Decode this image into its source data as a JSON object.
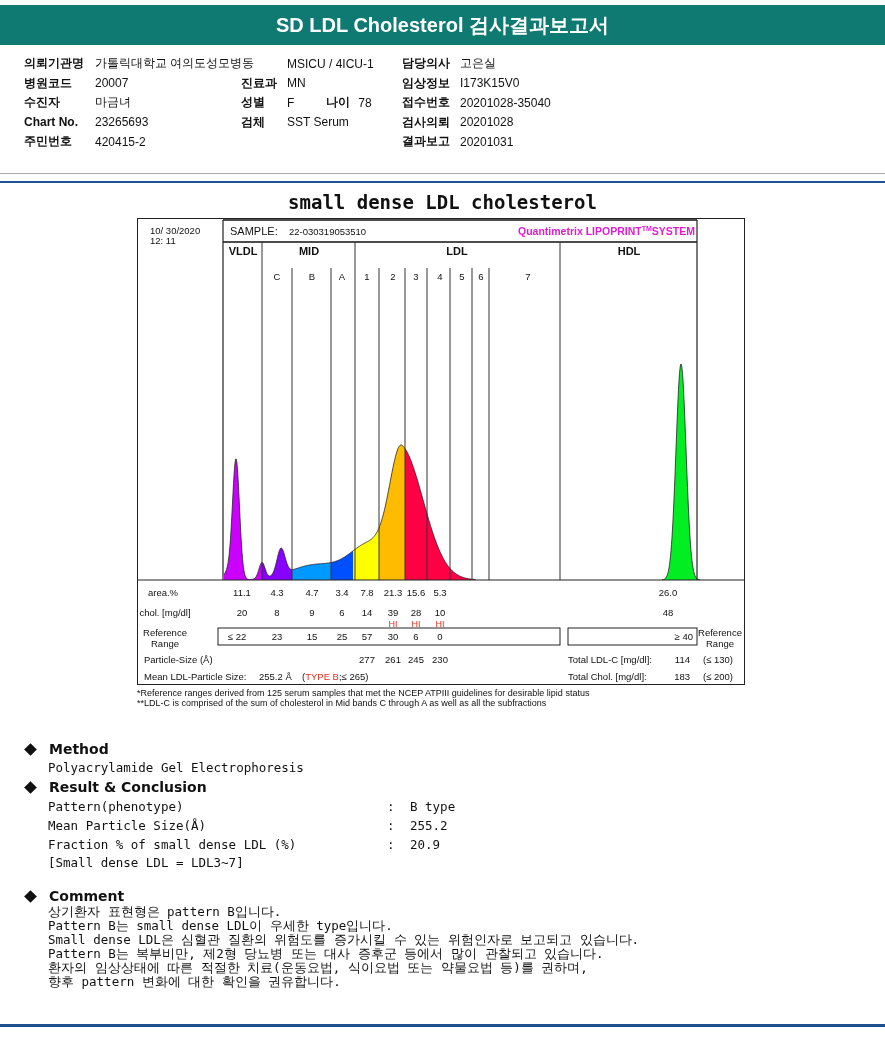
{
  "header": {
    "title": "SD LDL Cholesterol 검사결과보고서"
  },
  "info_rows": [
    {
      "left": {
        "label": "의뢰기관명",
        "value": "가톨릭대학교 여의도성모병동"
      },
      "middle": {
        "value": "MSICU / 4ICU-1"
      },
      "right": {
        "label": "담당의사",
        "value": "고은실"
      }
    },
    {
      "left": {
        "label": "병원코드",
        "value": "20007"
      },
      "middle": {
        "label": "진료과",
        "value": "MN"
      },
      "right": {
        "label": "임상정보",
        "value": "I173K15V0"
      }
    },
    {
      "left": {
        "label": "수진자",
        "value": "마금녀"
      },
      "middle": {
        "label": "성별",
        "value": "F",
        "extra": {
          "label": "나이",
          "value": "78"
        }
      },
      "right": {
        "label": "접수번호",
        "value": "20201028-35040"
      }
    },
    {
      "left": {
        "label": "Chart No.",
        "value": "23265693"
      },
      "middle": {
        "label": "검체",
        "value": "SST Serum"
      },
      "right": {
        "label": "검사의뢰",
        "value": "20201028"
      }
    },
    {
      "left": {
        "label": "주민번호",
        "value": "420415-2"
      },
      "right": {
        "label": "결과보고",
        "value": "20201031"
      }
    }
  ],
  "chart_title": "small dense LDL cholesterol",
  "report_figure": {
    "date": "10/ 30/2020",
    "time": "12: 11",
    "sample_label": "SAMPLE:",
    "sample_id": "22-030319053510",
    "system": {
      "name": "Quantimetrix LIPOPRINT",
      "mark": "TM",
      "suffix": "SYSTEM"
    },
    "band_groups": [
      "VLDL",
      "MID",
      "LDL",
      "HDL"
    ],
    "fractions": [
      {
        "area": "11.1",
        "chol": "20",
        "reference": "≤ 22"
      },
      {
        "label": "C",
        "area": "4.3",
        "chol": "8",
        "reference": "23"
      },
      {
        "label": "B",
        "area": "4.7",
        "chol": "9",
        "reference": "15"
      },
      {
        "label": "A",
        "area": "3.4",
        "chol": "6",
        "reference": "25"
      },
      {
        "label": "1",
        "area": "7.8",
        "chol": "14",
        "reference": "57",
        "particle_size": "277"
      },
      {
        "label": "2",
        "area": "21.3",
        "chol": "39",
        "chol_flag": "HI",
        "reference": "30",
        "particle_size": "261"
      },
      {
        "label": "3",
        "area": "15.6",
        "chol": "28",
        "chol_flag": "HI",
        "reference": "6",
        "particle_size": "245"
      },
      {
        "label": "4",
        "area": "5.3",
        "chol": "10",
        "chol_flag": "HI",
        "reference": "0",
        "particle_size": "230"
      },
      {
        "label": "5"
      },
      {
        "label": "6"
      },
      {
        "label": "7"
      },
      {
        "area": "26.0",
        "chol": "48",
        "reference": "≥ 40"
      }
    ],
    "row_labels": {
      "area": "area.%",
      "chol": "chol. [mg/dl]",
      "reference": "Reference Range",
      "reference_right": "Reference Range",
      "particle": "Particle-Size (Å)"
    },
    "particle": {
      "total_label": "Total LDL-C [mg/dl]:",
      "total_value": "114",
      "total_ref": "(≤ 130)"
    },
    "mean": {
      "label": "Mean LDL-Particle Size:",
      "value": "255.2 Å",
      "prefix": "(",
      "type": "TYPE B",
      "suffix": ";≤ 265)",
      "total_label": "Total Chol. [mg/dl]:",
      "total_value": "183",
      "total_ref": "(≤ 200)"
    },
    "footnotes": [
      "*Reference ranges derived from 125 serum samples that met the NCEP ATPIII guidelines for desirable lipid status",
      "**LDL-C is comprised of the sum of cholesterol in Mid bands C through A as well as all the subfractions"
    ]
  },
  "method": {
    "heading": "Method",
    "text": "Polyacrylamide Gel Electrophoresis"
  },
  "result": {
    "heading": "Result & Conclusion",
    "rows": [
      {
        "label": "Pattern(phenotype)",
        "sep": ":",
        "value": "B type"
      },
      {
        "label": "Mean Particle Size(Å)",
        "sep": ":",
        "value": "255.2"
      },
      {
        "label": "Fraction % of small dense LDL (%)",
        "sep": ":",
        "value": "20.9"
      }
    ],
    "note": "[Small dense LDL = LDL3~7]"
  },
  "comment": {
    "heading": "Comment",
    "lines": [
      "상기환자 표현형은 pattern B입니다.",
      "Pattern B는 small dense LDL이 우세한 type입니다.",
      "Small dense LDL은 심혈관 질환의 위험도를 증가시킬 수 있는 위험인자로 보고되고 있습니다.",
      "Pattern B는 복부비만, 제2형 당뇨병 또는 대사 증후군 등에서 많이 관찰되고 있습니다.",
      "환자의 임상상태에 따른 적절한 치료(운동요법, 식이요법 또는 약물요법 등)를 권하며,",
      "향후 pattern 변화에 대한 확인을 권유합니다."
    ]
  }
}
